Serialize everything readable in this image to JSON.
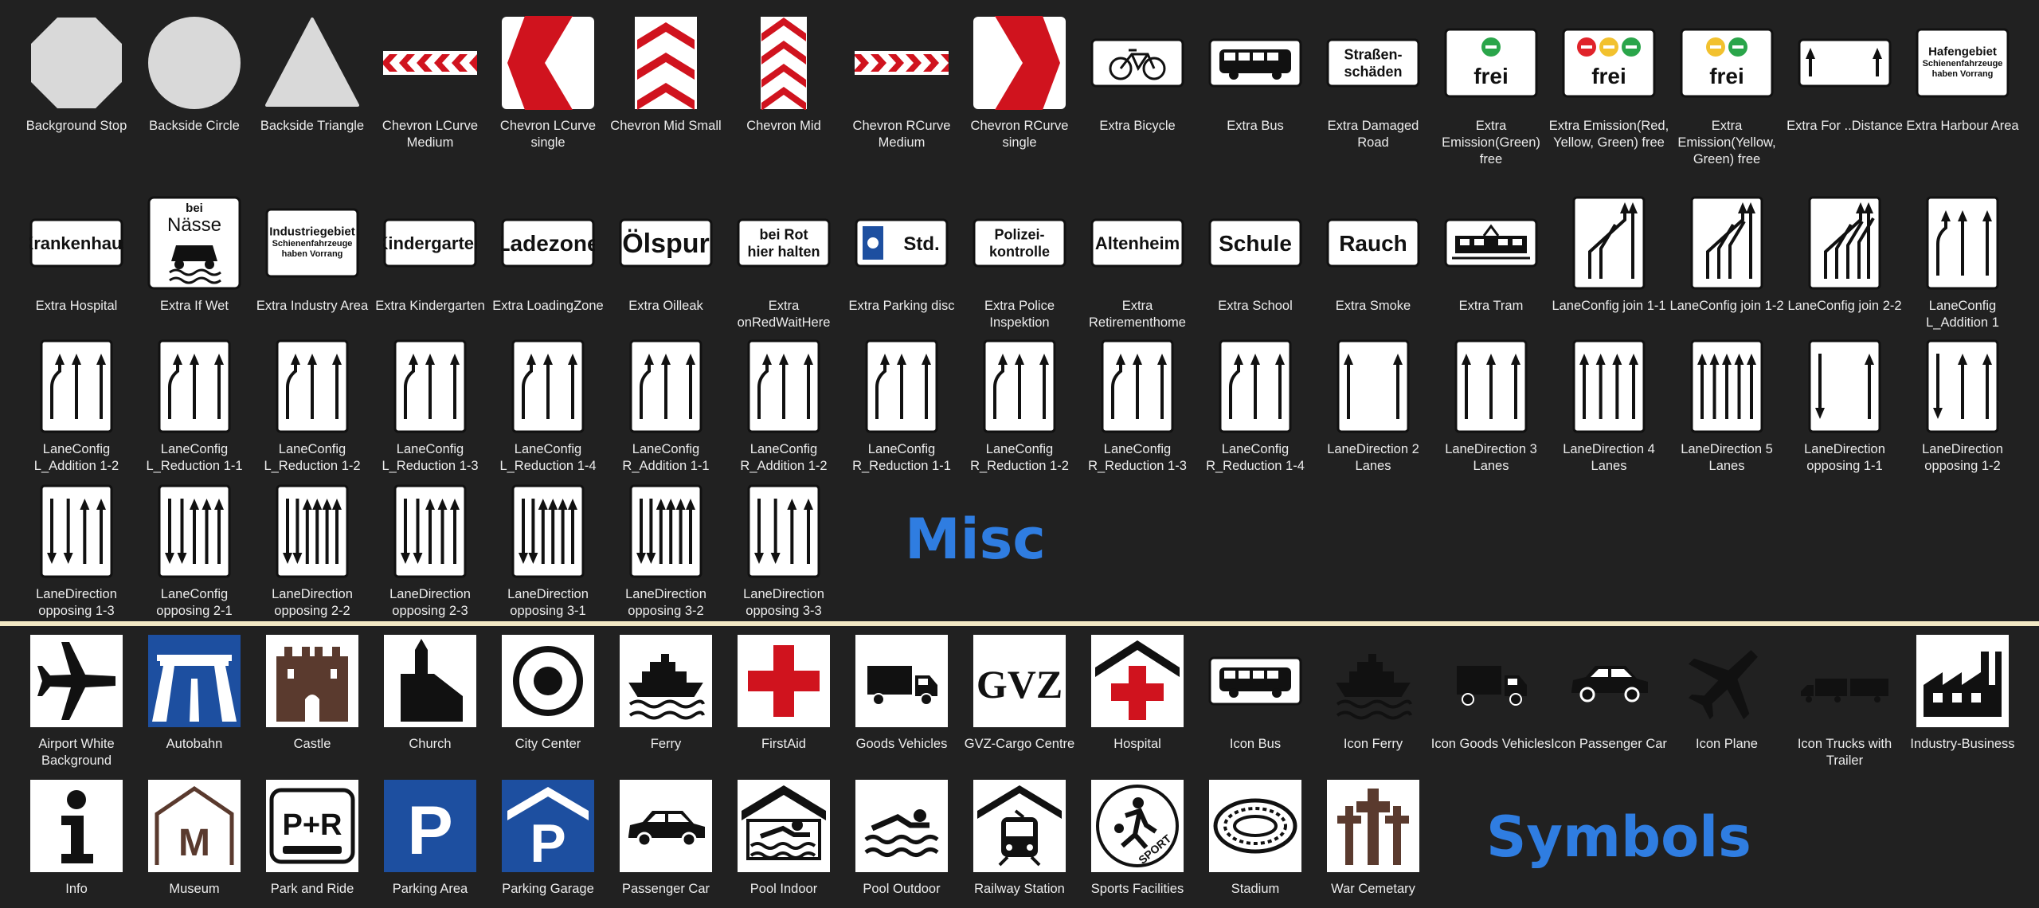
{
  "sections": {
    "misc": "Misc",
    "symbols": "Symbols"
  },
  "rows": [
    [
      {
        "label": "Background Stop",
        "icon": "octagon-icon"
      },
      {
        "label": "Backside Circle",
        "icon": "circle-icon"
      },
      {
        "label": "Backside Triangle",
        "icon": "triangle-icon"
      },
      {
        "label": "Chevron LCurve Medium",
        "icon": "chevron-left-medium-icon"
      },
      {
        "label": "Chevron LCurve single",
        "icon": "chevron-left-single-icon"
      },
      {
        "label": "Chevron Mid Small",
        "icon": "chevron-mid-small-icon"
      },
      {
        "label": "Chevron Mid",
        "icon": "chevron-mid-icon"
      },
      {
        "label": "Chevron RCurve Medium",
        "icon": "chevron-right-medium-icon"
      },
      {
        "label": "Chevron RCurve single",
        "icon": "chevron-right-single-icon"
      },
      {
        "label": "Extra Bicycle",
        "icon": "bicycle-icon"
      },
      {
        "label": "Extra Bus",
        "icon": "bus-icon"
      },
      {
        "label": "Extra Damaged Road",
        "icon": "damaged-road-plate-icon",
        "text": "Straßen-\nschäden"
      },
      {
        "label": "Extra Emission(Green) free",
        "icon": "emission-green-icon",
        "text": "frei"
      },
      {
        "label": "Extra Emission(Red, Yellow, Green) free",
        "icon": "emission-ryg-icon",
        "text": "frei"
      },
      {
        "label": "Extra Emission(Yellow, Green) free",
        "icon": "emission-yg-icon",
        "text": "frei"
      },
      {
        "label": "Extra For ..Distance",
        "icon": "distance-arrows-icon"
      },
      {
        "label": "Extra Harbour Area",
        "icon": "harbour-plate-icon",
        "text": "Hafengebiet\nSchienenfahrzeuge\nhaben Vorrang"
      }
    ],
    [
      {
        "label": "Extra Hospital",
        "icon": "hospital-plate-icon",
        "text": "Krankenhaus"
      },
      {
        "label": "Extra If Wet",
        "icon": "if-wet-icon",
        "text": "bei\nNässe"
      },
      {
        "label": "Extra Industry Area",
        "icon": "industry-plate-icon",
        "text": "Industriegebiet\nSchienenfahrzeuge\nhaben Vorrang"
      },
      {
        "label": "Extra Kindergarten",
        "icon": "kindergarten-plate-icon",
        "text": "Kindergarten"
      },
      {
        "label": "Extra LoadingZone",
        "icon": "loadingzone-plate-icon",
        "text": "Ladezone"
      },
      {
        "label": "Extra Oilleak",
        "icon": "oilleak-plate-icon",
        "text": "Ölspur"
      },
      {
        "label": "Extra onRedWaitHere",
        "icon": "redwait-plate-icon",
        "text": "bei Rot\nhier halten"
      },
      {
        "label": "Extra Parking disc",
        "icon": "parking-disc-icon",
        "text": "Std."
      },
      {
        "label": "Extra Police Inspektion",
        "icon": "police-plate-icon",
        "text": "Polizei-\nkontrolle"
      },
      {
        "label": "Extra Retirementhome",
        "icon": "retirement-plate-icon",
        "text": "Altenheim"
      },
      {
        "label": "Extra School",
        "icon": "school-plate-icon",
        "text": "Schule"
      },
      {
        "label": "Extra Smoke",
        "icon": "smoke-plate-icon",
        "text": "Rauch"
      },
      {
        "label": "Extra Tram",
        "icon": "tram-icon"
      },
      {
        "label": "LaneConfig join 1-1",
        "icon": "lane-join-icon"
      },
      {
        "label": "LaneConfig join 1-2",
        "icon": "lane-join-icon"
      },
      {
        "label": "LaneConfig join 2-2",
        "icon": "lane-join-icon"
      },
      {
        "label": "LaneConfig L_Addition 1",
        "icon": "lane-addition-icon"
      }
    ],
    [
      {
        "label": "LaneConfig L_Addition 1-2",
        "icon": "lane-addition-icon"
      },
      {
        "label": "LaneConfig L_Reduction 1-1",
        "icon": "lane-reduction-icon"
      },
      {
        "label": "LaneConfig L_Reduction 1-2",
        "icon": "lane-reduction-icon"
      },
      {
        "label": "LaneConfig L_Reduction 1-3",
        "icon": "lane-reduction-icon"
      },
      {
        "label": "LaneConfig L_Reduction 1-4",
        "icon": "lane-reduction-icon"
      },
      {
        "label": "LaneConfig R_Addition 1-1",
        "icon": "lane-addition-icon"
      },
      {
        "label": "LaneConfig R_Addition 1-2",
        "icon": "lane-addition-icon"
      },
      {
        "label": "LaneConfig R_Reduction 1-1",
        "icon": "lane-reduction-icon"
      },
      {
        "label": "LaneConfig R_Reduction 1-2",
        "icon": "lane-reduction-icon"
      },
      {
        "label": "LaneConfig R_Reduction 1-3",
        "icon": "lane-reduction-icon"
      },
      {
        "label": "LaneConfig R_Reduction 1-4",
        "icon": "lane-reduction-icon"
      },
      {
        "label": "LaneDirection 2 Lanes",
        "icon": "lane-direction-icon"
      },
      {
        "label": "LaneDirection 3 Lanes",
        "icon": "lane-direction-icon"
      },
      {
        "label": "LaneDirection 4 Lanes",
        "icon": "lane-direction-icon"
      },
      {
        "label": "LaneDirection 5 Lanes",
        "icon": "lane-direction-icon"
      },
      {
        "label": "LaneDirection opposing 1-1",
        "icon": "lane-opposing-icon"
      },
      {
        "label": "LaneDirection opposing 1-2",
        "icon": "lane-opposing-icon"
      }
    ],
    [
      {
        "label": "LaneDirection opposing 1-3",
        "icon": "lane-opposing-icon"
      },
      {
        "label": "LaneConfig opposing 2-1",
        "icon": "lane-opposing-icon"
      },
      {
        "label": "LaneDirection opposing 2-2",
        "icon": "lane-opposing-icon"
      },
      {
        "label": "LaneDirection opposing 2-3",
        "icon": "lane-opposing-icon"
      },
      {
        "label": "LaneDirection opposing 3-1",
        "icon": "lane-opposing-icon"
      },
      {
        "label": "LaneDirection opposing 3-2",
        "icon": "lane-opposing-icon"
      },
      {
        "label": "LaneDirection opposing 3-3",
        "icon": "lane-opposing-icon"
      }
    ],
    [
      {
        "label": "Airport White Background",
        "icon": "airplane-icon"
      },
      {
        "label": "Autobahn",
        "icon": "autobahn-icon"
      },
      {
        "label": "Castle",
        "icon": "castle-icon"
      },
      {
        "label": "Church",
        "icon": "church-icon"
      },
      {
        "label": "City Center",
        "icon": "city-center-icon"
      },
      {
        "label": "Ferry",
        "icon": "ferry-icon"
      },
      {
        "label": "FirstAid",
        "icon": "first-aid-icon"
      },
      {
        "label": "Goods Vehicles",
        "icon": "truck-icon"
      },
      {
        "label": "GVZ-Cargo Centre",
        "icon": "gvz-icon",
        "text": "GVZ"
      },
      {
        "label": "Hospital",
        "icon": "hospital-icon"
      },
      {
        "label": "Icon Bus",
        "icon": "bus-icon"
      },
      {
        "label": "Icon Ferry",
        "icon": "ferry-icon"
      },
      {
        "label": "Icon Goods Vehicles",
        "icon": "truck-icon"
      },
      {
        "label": "Icon Passenger Car",
        "icon": "car-icon"
      },
      {
        "label": "Icon Plane",
        "icon": "airplane-icon"
      },
      {
        "label": "Icon Trucks with Trailer",
        "icon": "truck-trailer-icon"
      },
      {
        "label": "Industry-Business",
        "icon": "factory-icon"
      }
    ],
    [
      {
        "label": "Info",
        "icon": "info-icon"
      },
      {
        "label": "Museum",
        "icon": "museum-icon",
        "text": "M"
      },
      {
        "label": "Park and Ride",
        "icon": "park-ride-icon",
        "text": "P+R"
      },
      {
        "label": "Parking Area",
        "icon": "parking-icon",
        "text": "P"
      },
      {
        "label": "Parking Garage",
        "icon": "parking-garage-icon",
        "text": "P"
      },
      {
        "label": "Passenger Car",
        "icon": "car-icon"
      },
      {
        "label": "Pool Indoor",
        "icon": "pool-indoor-icon"
      },
      {
        "label": "Pool Outdoor",
        "icon": "pool-outdoor-icon"
      },
      {
        "label": "Railway Station",
        "icon": "railway-icon"
      },
      {
        "label": "Sports Facilities",
        "icon": "sports-icon",
        "text": "SPORT"
      },
      {
        "label": "Stadium",
        "icon": "stadium-icon"
      },
      {
        "label": "War Cemetary",
        "icon": "cemetery-icon"
      }
    ]
  ]
}
